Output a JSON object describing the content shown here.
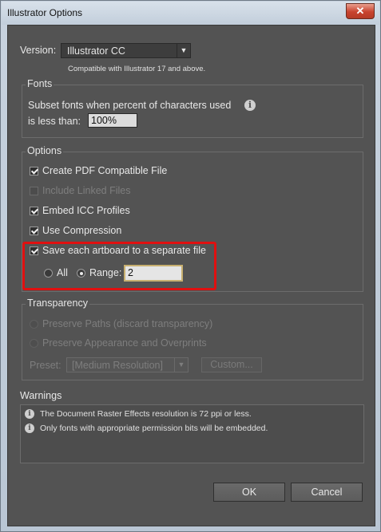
{
  "window": {
    "title": "Illustrator Options",
    "close_glyph": "✕"
  },
  "version": {
    "label": "Version:",
    "selected": "Illustrator CC",
    "note": "Compatible with Illustrator 17 and above."
  },
  "fonts": {
    "title": "Fonts",
    "subset_text_line1": "Subset fonts when percent of characters used",
    "subset_text_line2": "is less than:",
    "percent_value": "100%"
  },
  "options": {
    "title": "Options",
    "create_pdf": {
      "label": "Create PDF Compatible File",
      "checked": true,
      "enabled": true
    },
    "include_linked": {
      "label": "Include Linked Files",
      "checked": false,
      "enabled": false
    },
    "embed_icc": {
      "label": "Embed ICC Profiles",
      "checked": true,
      "enabled": true
    },
    "use_compression": {
      "label": "Use Compression",
      "checked": true,
      "enabled": true
    },
    "save_artboards": {
      "label": "Save each artboard to a separate file",
      "checked": true,
      "enabled": true
    },
    "all_label": "All",
    "range_label": "Range:",
    "range_value": "2"
  },
  "transparency": {
    "title": "Transparency",
    "preserve_paths": "Preserve Paths (discard transparency)",
    "preserve_appearance": "Preserve Appearance and Overprints",
    "preset_label": "Preset:",
    "preset_value": "[Medium Resolution]",
    "custom_button": "Custom..."
  },
  "warnings": {
    "title": "Warnings",
    "items": [
      "The Document Raster Effects resolution is 72 ppi or less.",
      "Only fonts with appropriate permission bits will be embedded."
    ]
  },
  "buttons": {
    "ok": "OK",
    "cancel": "Cancel"
  },
  "icons": {
    "info": "i",
    "dropdown": "▼"
  },
  "colors": {
    "dialog_bg": "#535353",
    "highlight": "#e01010"
  }
}
